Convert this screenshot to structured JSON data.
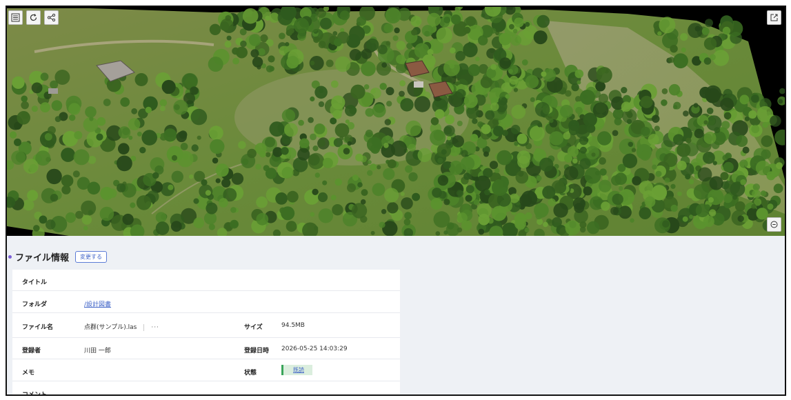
{
  "viewer": {
    "toolbar": {
      "menu_icon": "hamburger-menu-icon",
      "reload_icon": "reload-icon",
      "share_icon": "share-icon",
      "external_icon": "external-link-icon",
      "zoom_icon": "zoom-out-icon"
    },
    "colors": {
      "background": "#000000",
      "ground": "#6e8a3c",
      "tree_dark": "#2f5a1e",
      "tree_light": "#6aa035",
      "roof": "#8a5a42"
    }
  },
  "file_info": {
    "title": "ファイル情報",
    "edit_label": "変更する",
    "rows": {
      "title_label": "タイトル",
      "title_value": "",
      "folder_label": "フォルダ",
      "folder_value": "/設計図書",
      "filename_label": "ファイル名",
      "filename_value": "点群(サンプル).las",
      "more_label": "···",
      "size_label": "サイズ",
      "size_value": "94.5MB",
      "registrant_label": "登録者",
      "registrant_value": "川田 一郎",
      "registered_at_label": "登録日時",
      "registered_at_value": "2026-05-25 14:03:29",
      "memo_label": "メモ",
      "memo_value": "",
      "status_label": "状態",
      "status_value": "既読",
      "comment_label": "コメント"
    },
    "colors": {
      "accent": "#3f63c7",
      "status_bg": "#dbeede",
      "status_border": "#3aa55a",
      "bullet": "#7b5fd6"
    }
  }
}
